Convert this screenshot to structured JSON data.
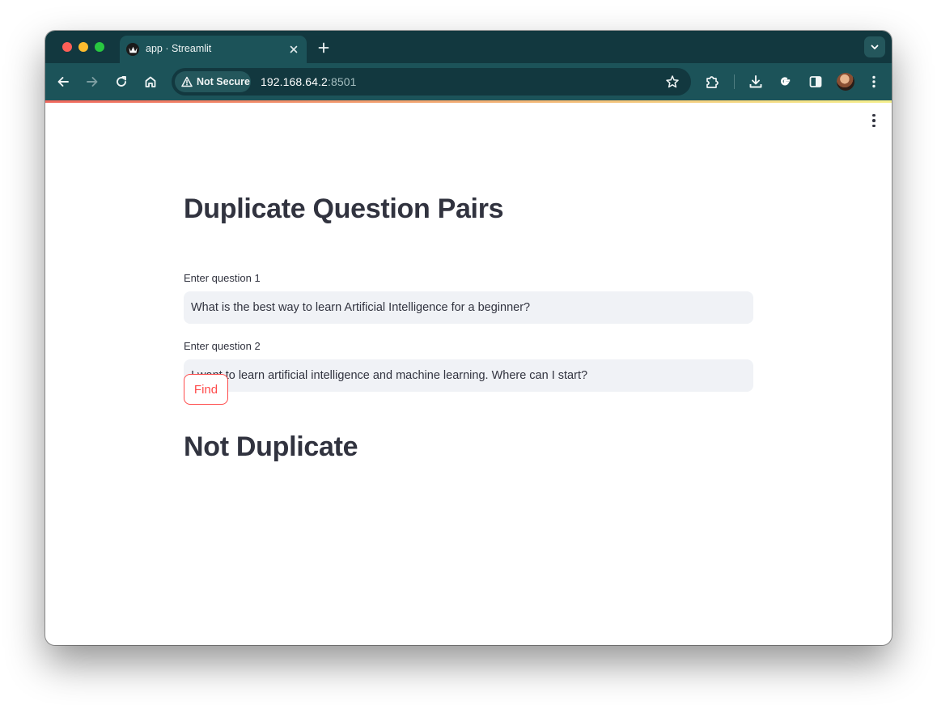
{
  "browser": {
    "tab_title": "app · Streamlit",
    "security_label": "Not Secure",
    "url_host": "192.168.64.2",
    "url_port": ":8501"
  },
  "app": {
    "title": "Duplicate Question Pairs",
    "question1": {
      "label": "Enter question 1",
      "value": "What is the best way to learn Artificial Intelligence for a beginner?"
    },
    "question2": {
      "label": "Enter question 2",
      "value": "I want to learn artificial intelligence and machine learning. Where can I start?"
    },
    "button_label": "Find",
    "result": "Not Duplicate"
  },
  "colors": {
    "accent": "#ff4b4b",
    "text": "#31333f",
    "input_background": "#f0f2f6",
    "chrome_dark": "#12383f",
    "chrome_toolbar": "#1c5359"
  },
  "icons": [
    "streamlit-favicon",
    "close-icon",
    "plus-icon",
    "chevron-down-icon",
    "back-arrow-icon",
    "forward-arrow-icon",
    "reload-icon",
    "home-icon",
    "warning-icon",
    "star-icon",
    "extensions-icon",
    "download-icon",
    "google-icon",
    "side-panel-icon",
    "kebab-menu-icon",
    "avatar"
  ]
}
